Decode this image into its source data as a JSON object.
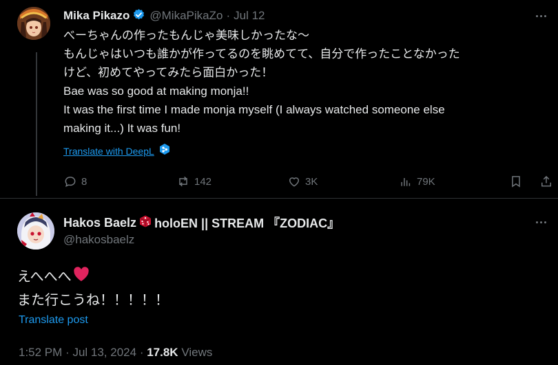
{
  "tweet": {
    "author_name": "Mika Pikazo",
    "handle": "@MikaPikaZo",
    "separator": "·",
    "date": "Jul 12",
    "lines": [
      "べーちゃんの作ったもんじゃ美味しかったな〜",
      "もんじゃはいつも誰かが作ってるのを眺めてて、自分で作ったことなかった",
      "けど、初めてやってみたら面白かった！",
      "Bae was so good at making monja!!",
      "It was the first time I made monja myself (I always watched someone else",
      "making it...) It was fun!"
    ],
    "translate_label": "Translate with DeepL",
    "stats": {
      "replies": "8",
      "reposts": "142",
      "likes": "3K",
      "views": "79K"
    }
  },
  "reply": {
    "author_name": "Hakos Baelz",
    "author_name_suffix": "holoEN || STREAM 『ZODIAC』",
    "handle": "@hakosbaelz",
    "lines": [
      "えへへへ",
      "また行こうね！！！！！"
    ],
    "translate_label": "Translate post",
    "time": "1:52 PM",
    "date": "Jul 13, 2024",
    "views_count": "17.8K",
    "views_label": "Views"
  },
  "colors": {
    "accent": "#1d9bf0",
    "heart": "#e0245e",
    "dice": "#c8102e",
    "verified": "#1d9bf0"
  }
}
